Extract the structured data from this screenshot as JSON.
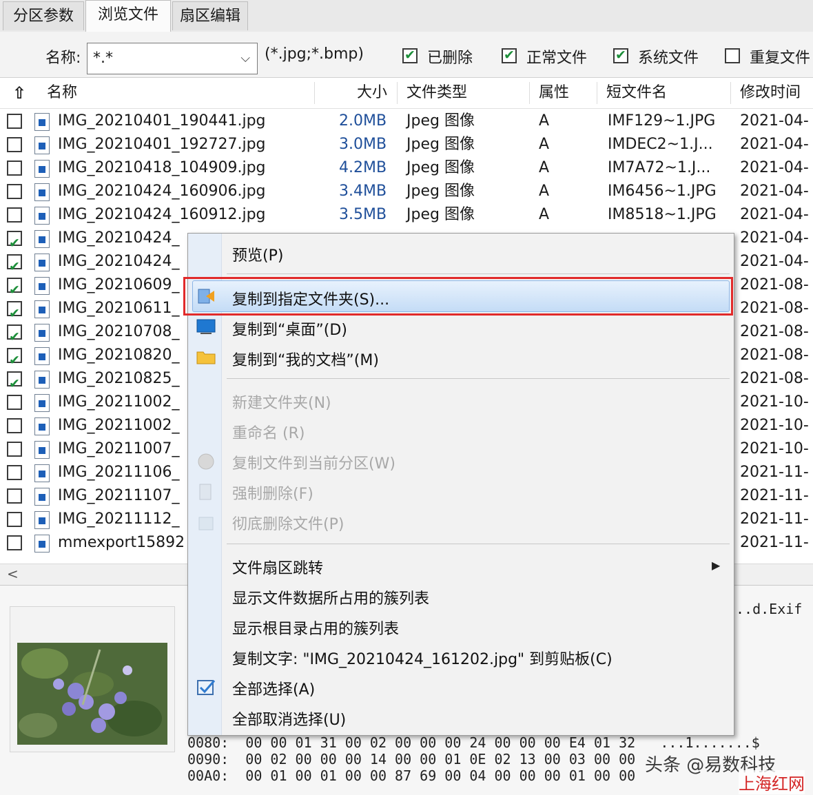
{
  "tabs": [
    {
      "label": "分区参数",
      "active": false
    },
    {
      "label": "浏览文件",
      "active": true
    },
    {
      "label": "扇区编辑",
      "active": false
    }
  ],
  "filter": {
    "name_label": "名称:",
    "name_value": "*.*",
    "hint": "(*.jpg;*.bmp)",
    "checkboxes": [
      {
        "label": "已删除",
        "checked": true
      },
      {
        "label": "正常文件",
        "checked": true
      },
      {
        "label": "系统文件",
        "checked": true
      },
      {
        "label": "重复文件",
        "checked": false
      }
    ]
  },
  "list": {
    "columns": [
      "名称",
      "大小",
      "文件类型",
      "属性",
      "短文件名",
      "修改时间"
    ],
    "rows": [
      {
        "checked": false,
        "name": "IMG_20210401_190441.jpg",
        "size": "2.0MB",
        "type": "Jpeg 图像",
        "attr": "A",
        "short": "IMF129~1.JPG",
        "mtime": "2021-04-"
      },
      {
        "checked": false,
        "name": "IMG_20210401_192727.jpg",
        "size": "3.0MB",
        "type": "Jpeg 图像",
        "attr": "A",
        "short": "IMDEC2~1.J...",
        "mtime": "2021-04-"
      },
      {
        "checked": false,
        "name": "IMG_20210418_104909.jpg",
        "size": "4.2MB",
        "type": "Jpeg 图像",
        "attr": "A",
        "short": "IM7A72~1.J...",
        "mtime": "2021-04-"
      },
      {
        "checked": false,
        "name": "IMG_20210424_160906.jpg",
        "size": "3.4MB",
        "type": "Jpeg 图像",
        "attr": "A",
        "short": "IM6456~1.JPG",
        "mtime": "2021-04-"
      },
      {
        "checked": false,
        "name": "IMG_20210424_160912.jpg",
        "size": "3.5MB",
        "type": "Jpeg 图像",
        "attr": "A",
        "short": "IM8518~1.JPG",
        "mtime": "2021-04-"
      },
      {
        "checked": true,
        "name": "IMG_20210424_",
        "size": "",
        "type": "",
        "attr": "",
        "short": "",
        "mtime": "2021-04-"
      },
      {
        "checked": true,
        "name": "IMG_20210424_",
        "size": "",
        "type": "",
        "attr": "",
        "short": "",
        "mtime": "2021-04-"
      },
      {
        "checked": true,
        "name": "IMG_20210609_",
        "size": "",
        "type": "",
        "attr": "",
        "short": "",
        "mtime": "2021-08-"
      },
      {
        "checked": true,
        "name": "IMG_20210611_",
        "size": "",
        "type": "",
        "attr": "",
        "short": "",
        "mtime": "2021-08-"
      },
      {
        "checked": true,
        "name": "IMG_20210708_",
        "size": "",
        "type": "",
        "attr": "",
        "short": "",
        "mtime": "2021-08-"
      },
      {
        "checked": true,
        "name": "IMG_20210820_",
        "size": "",
        "type": "",
        "attr": "",
        "short": "",
        "mtime": "2021-08-"
      },
      {
        "checked": true,
        "name": "IMG_20210825_",
        "size": "",
        "type": "",
        "attr": "",
        "short": "",
        "mtime": "2021-08-"
      },
      {
        "checked": false,
        "name": "IMG_20211002_",
        "size": "",
        "type": "",
        "attr": "",
        "short": "",
        "mtime": "2021-10-"
      },
      {
        "checked": false,
        "name": "IMG_20211002_",
        "size": "",
        "type": "",
        "attr": "",
        "short": "",
        "mtime": "2021-10-"
      },
      {
        "checked": false,
        "name": "IMG_20211007_",
        "size": "",
        "type": "",
        "attr": "",
        "short": "",
        "mtime": "2021-10-"
      },
      {
        "checked": false,
        "name": "IMG_20211106_",
        "size": "",
        "type": "",
        "attr": "",
        "short": "",
        "mtime": "2021-11-"
      },
      {
        "checked": false,
        "name": "IMG_20211107_",
        "size": "",
        "type": "",
        "attr": "",
        "short": "",
        "mtime": "2021-11-"
      },
      {
        "checked": false,
        "name": "IMG_20211112_",
        "size": "",
        "type": "",
        "attr": "",
        "short": "",
        "mtime": "2021-11-"
      },
      {
        "checked": false,
        "name": "mmexport15892",
        "size": "",
        "type": "",
        "attr": "",
        "short": "",
        "mtime": "2021-11-"
      }
    ]
  },
  "context_menu": {
    "items": [
      {
        "label": "预览(P)",
        "disabled": false,
        "icon": ""
      },
      {
        "label": "复制到指定文件夹(S)...",
        "disabled": false,
        "icon": "copy-to-folder-icon",
        "highlighted": true
      },
      {
        "label": "复制到“桌面”(D)",
        "disabled": false,
        "icon": "desktop-icon"
      },
      {
        "label": "复制到“我的文档”(M)",
        "disabled": false,
        "icon": "folder-icon"
      },
      {
        "label": "新建文件夹(N)",
        "disabled": true,
        "icon": ""
      },
      {
        "label": "重命名 (R)",
        "disabled": true,
        "icon": ""
      },
      {
        "label": "复制文件到当前分区(W)",
        "disabled": true,
        "icon": "disk-icon"
      },
      {
        "label": "强制删除(F)",
        "disabled": true,
        "icon": "delete-file-icon"
      },
      {
        "label": "彻底删除文件(P)",
        "disabled": true,
        "icon": "trash-icon"
      },
      {
        "label": "文件扇区跳转",
        "disabled": false,
        "icon": "",
        "submenu": true
      },
      {
        "label": "显示文件数据所占用的簇列表",
        "disabled": false,
        "icon": ""
      },
      {
        "label": "显示根目录占用的簇列表",
        "disabled": false,
        "icon": ""
      },
      {
        "label": "复制文字: \"IMG_20210424_161202.jpg\" 到剪贴板(C)",
        "disabled": false,
        "icon": ""
      },
      {
        "label": "全部选择(A)",
        "disabled": false,
        "icon": "select-all-icon"
      },
      {
        "label": "全部取消选择(U)",
        "disabled": false,
        "icon": ""
      }
    ]
  },
  "hex": {
    "right_text": "..d.Exif",
    "lines": [
      "0080:  00 00 01 31 00 02 00 00 00 24 00 00 00 E4 01 32   ...1.......$",
      "0090:  00 02 00 00 00 14 00 00 01 0E 02 13 00 03 00 00",
      "00A0:  00 01 00 01 00 00 87 69 00 04 00 00 00 01 00 00"
    ]
  },
  "watermark": {
    "line1": "头条 @易数科技",
    "line2": "上海红网"
  }
}
